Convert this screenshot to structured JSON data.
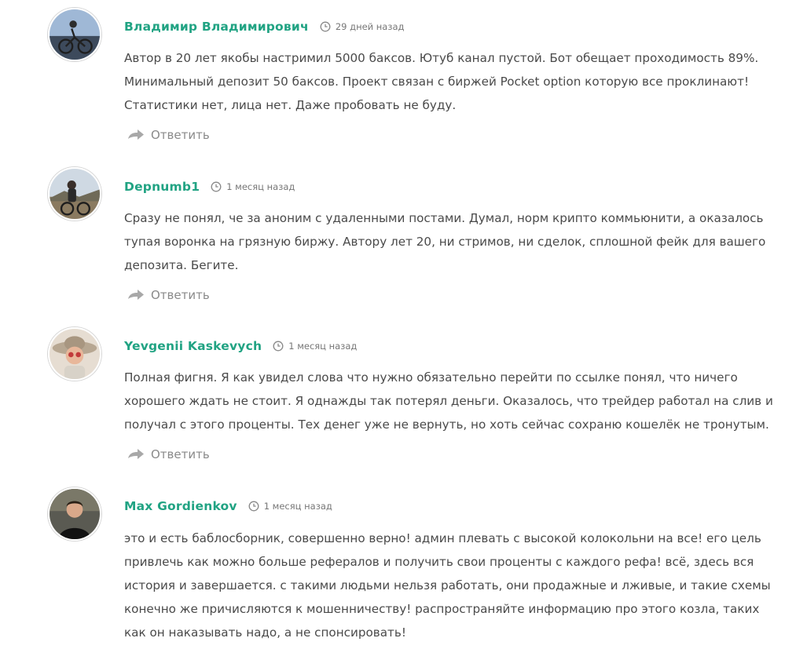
{
  "comments": [
    {
      "author": "Владимир Владимирович",
      "time": "29 дней назад",
      "text": "Автор в 20 лет якобы настримил 5000 баксов. Ютуб канал пустой. Бот обещает проходимость 89%. Минимальный депозит 50 баксов. Проект связан с биржей Pocket option которую все проклинают! Статистики нет, лица нет. Даже пробовать не буду.",
      "reply_label": "Ответить"
    },
    {
      "author": "Depnumb1",
      "time": "1 месяц назад",
      "text": "Сразу не понял, че за аноним с удаленными постами. Думал, норм крипто коммьюнити, а оказалось тупая воронка на грязную биржу. Автору лет 20, ни стримов, ни сделок, сплошной фейк для вашего депозита. Бегите.",
      "reply_label": "Ответить"
    },
    {
      "author": "Yevgenii Kaskevych",
      "time": "1 месяц назад",
      "text": "Полная фигня. Я как увидел слова что нужно обязательно перейти по ссылке понял, что ничего хорошего ждать не стоит. Я однажды так потерял деньги. Оказалось, что трейдер работал на слив и получал с этого проценты. Тех денег уже не вернуть, но хоть сейчас сохраню кошелёк не тронутым.",
      "reply_label": "Ответить"
    },
    {
      "author": "Max Gordienkov",
      "time": "1 месяц назад",
      "text": "это и есть баблосборник, совершенно верно! админ плевать с высокой колокольни на все! его цель привлечь как можно больше рефералов и получить свои проценты с каждого рефа! всё, здесь вся история и завершается. с такими людьми нельзя работать, они продажные и лживые, и такие схемы конечно же причисляются к мошенничеству! распространяйте информацию про этого козла, таких как он наказывать надо, а не спонсировать!"
    }
  ],
  "colors": {
    "author": "#21a383",
    "meta": "#777777",
    "text": "#4a4a4a",
    "reply": "#8a8a8a"
  },
  "icons": {
    "time": "clock-icon",
    "reply": "reply-arrow-icon"
  }
}
